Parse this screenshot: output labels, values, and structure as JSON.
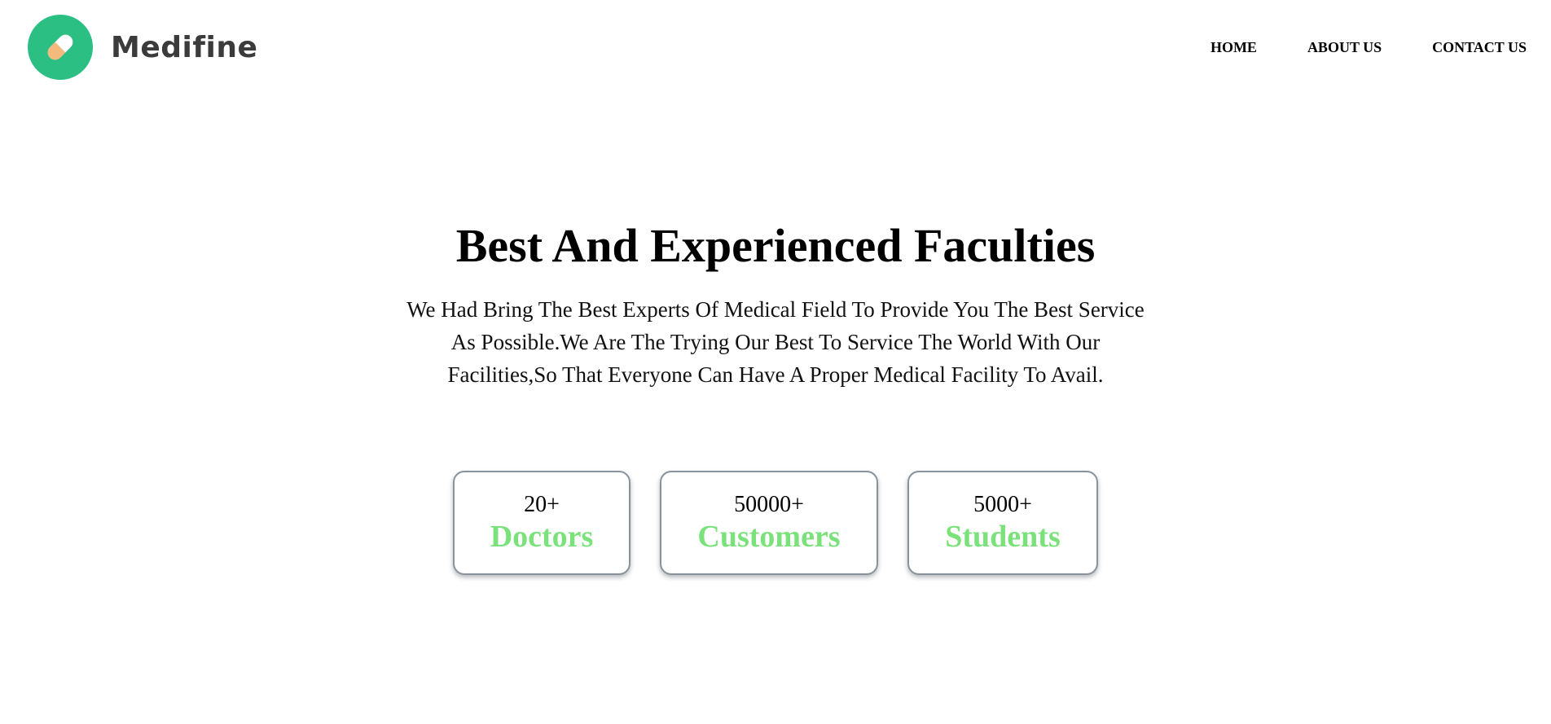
{
  "brand": {
    "name": "Medifine",
    "logo_color": "#2bbf83",
    "logo_icon": "pill-icon"
  },
  "nav": {
    "items": [
      {
        "label": "HOME"
      },
      {
        "label": "ABOUT US"
      },
      {
        "label": "CONTACT US"
      }
    ]
  },
  "hero": {
    "title": "Best And Experienced Faculties",
    "description": "We Had Bring The Best Experts Of Medical Field To Provide You The Best Service As Possible.We Are The Trying Our Best To Service The World With Our Facilities,So That Everyone Can Have A Proper Medical Facility To Avail."
  },
  "stats": [
    {
      "value": "20+",
      "label": "Doctors"
    },
    {
      "value": "50000+",
      "label": "Customers"
    },
    {
      "value": "5000+",
      "label": "Students"
    }
  ],
  "colors": {
    "accent_green": "#7be27b",
    "card_border": "#8a939c"
  }
}
